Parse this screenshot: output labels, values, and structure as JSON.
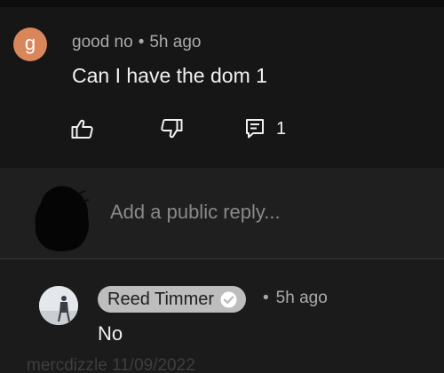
{
  "comment": {
    "avatar_letter": "g",
    "avatar_color": "#d9875a",
    "author": "good no",
    "separator": "•",
    "time": "5h ago",
    "text": "Can I have the dom 1",
    "actions": {
      "like_icon": "thumbs-up-icon",
      "dislike_icon": "thumbs-down-icon",
      "reply_icon": "comment-icon",
      "reply_count": "1"
    }
  },
  "reply_box": {
    "placeholder": "Add a public reply..."
  },
  "reply": {
    "author": "Reed Timmer",
    "verified_icon": "verified-check-icon",
    "separator": "•",
    "time": "5h ago",
    "text": "No"
  },
  "watermark": {
    "text": "mercdizzle 11/09/2022"
  },
  "colors": {
    "background": "#1b1b1b",
    "comment_background": "#161616",
    "reply_box_background": "#1f1f1f",
    "author_chip": "#bdbdbd"
  }
}
